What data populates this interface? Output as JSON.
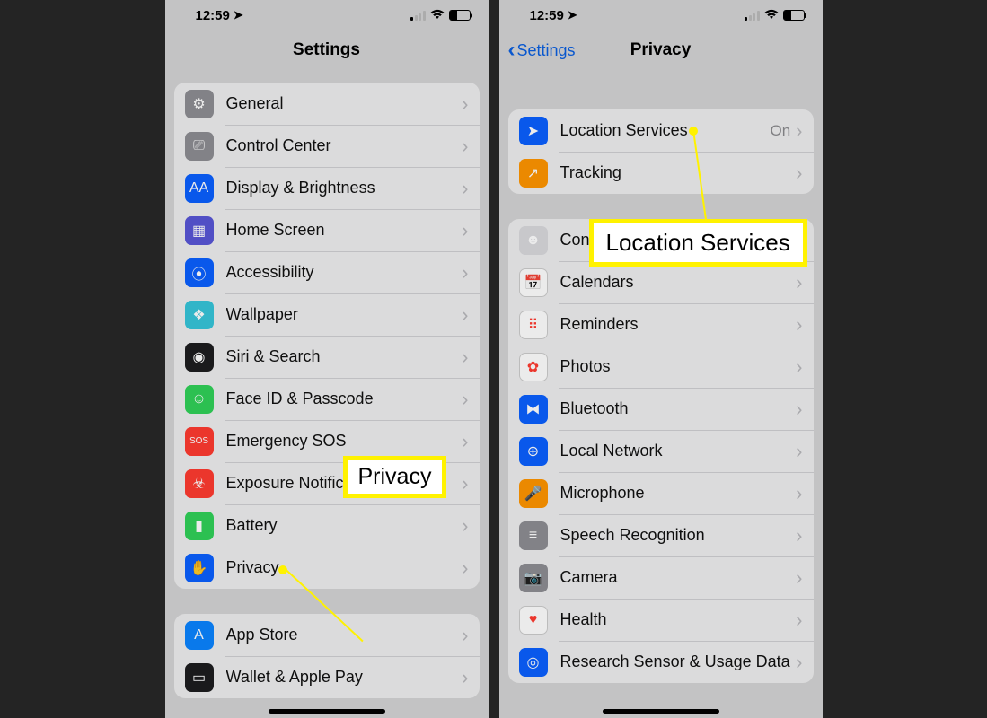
{
  "status": {
    "time": "12:59",
    "battery_pct": 40
  },
  "left": {
    "title": "Settings",
    "callout_label": "Privacy",
    "group1": [
      {
        "label": "General",
        "color": "#8e8e93",
        "glyph": "⚙"
      },
      {
        "label": "Control Center",
        "color": "#8e8e93",
        "glyph": "⎚"
      },
      {
        "label": "Display & Brightness",
        "color": "#0a60ff",
        "glyph": "AA"
      },
      {
        "label": "Home Screen",
        "color": "#5856d6",
        "glyph": "▦"
      },
      {
        "label": "Accessibility",
        "color": "#0a60ff",
        "glyph": "⦿"
      },
      {
        "label": "Wallpaper",
        "color": "#36c5d9",
        "glyph": "❖"
      },
      {
        "label": "Siri & Search",
        "color": "#1d1d1f",
        "glyph": "◉"
      },
      {
        "label": "Face ID & Passcode",
        "color": "#30d158",
        "glyph": "☺"
      },
      {
        "label": "Emergency SOS",
        "color": "#ff3b30",
        "glyph": "SOS"
      },
      {
        "label": "Exposure Notifications",
        "color": "#ff3b30",
        "glyph": "☣"
      },
      {
        "label": "Battery",
        "color": "#30d158",
        "glyph": "▮"
      },
      {
        "label": "Privacy",
        "color": "#0a60ff",
        "glyph": "✋"
      }
    ],
    "group2": [
      {
        "label": "App Store",
        "color": "#0a84ff",
        "glyph": "A"
      },
      {
        "label": "Wallet & Apple Pay",
        "color": "#1d1d1f",
        "glyph": "▭"
      }
    ]
  },
  "right": {
    "title": "Privacy",
    "back_label": "Settings",
    "callout_label": "Location Services",
    "group1": [
      {
        "label": "Location Services",
        "value": "On",
        "color": "#0a60ff",
        "glyph": "➤"
      },
      {
        "label": "Tracking",
        "color": "#ff9500",
        "glyph": "↗"
      }
    ],
    "group2": [
      {
        "label": "Contacts",
        "color": "#d9d9dd",
        "glyph": "☻"
      },
      {
        "label": "Calendars",
        "color": "#ffffff",
        "glyph": "📅"
      },
      {
        "label": "Reminders",
        "color": "#ffffff",
        "glyph": "⠿"
      },
      {
        "label": "Photos",
        "color": "#ffffff",
        "glyph": "✿"
      },
      {
        "label": "Bluetooth",
        "color": "#0a60ff",
        "glyph": "⧓"
      },
      {
        "label": "Local Network",
        "color": "#0a60ff",
        "glyph": "⊕"
      },
      {
        "label": "Microphone",
        "color": "#ff9500",
        "glyph": "🎤"
      },
      {
        "label": "Speech Recognition",
        "color": "#8e8e93",
        "glyph": "≡"
      },
      {
        "label": "Camera",
        "color": "#8e8e93",
        "glyph": "📷"
      },
      {
        "label": "Health",
        "color": "#ffffff",
        "glyph": "♥"
      },
      {
        "label": "Research Sensor & Usage Data",
        "color": "#0a60ff",
        "glyph": "◎"
      }
    ]
  }
}
